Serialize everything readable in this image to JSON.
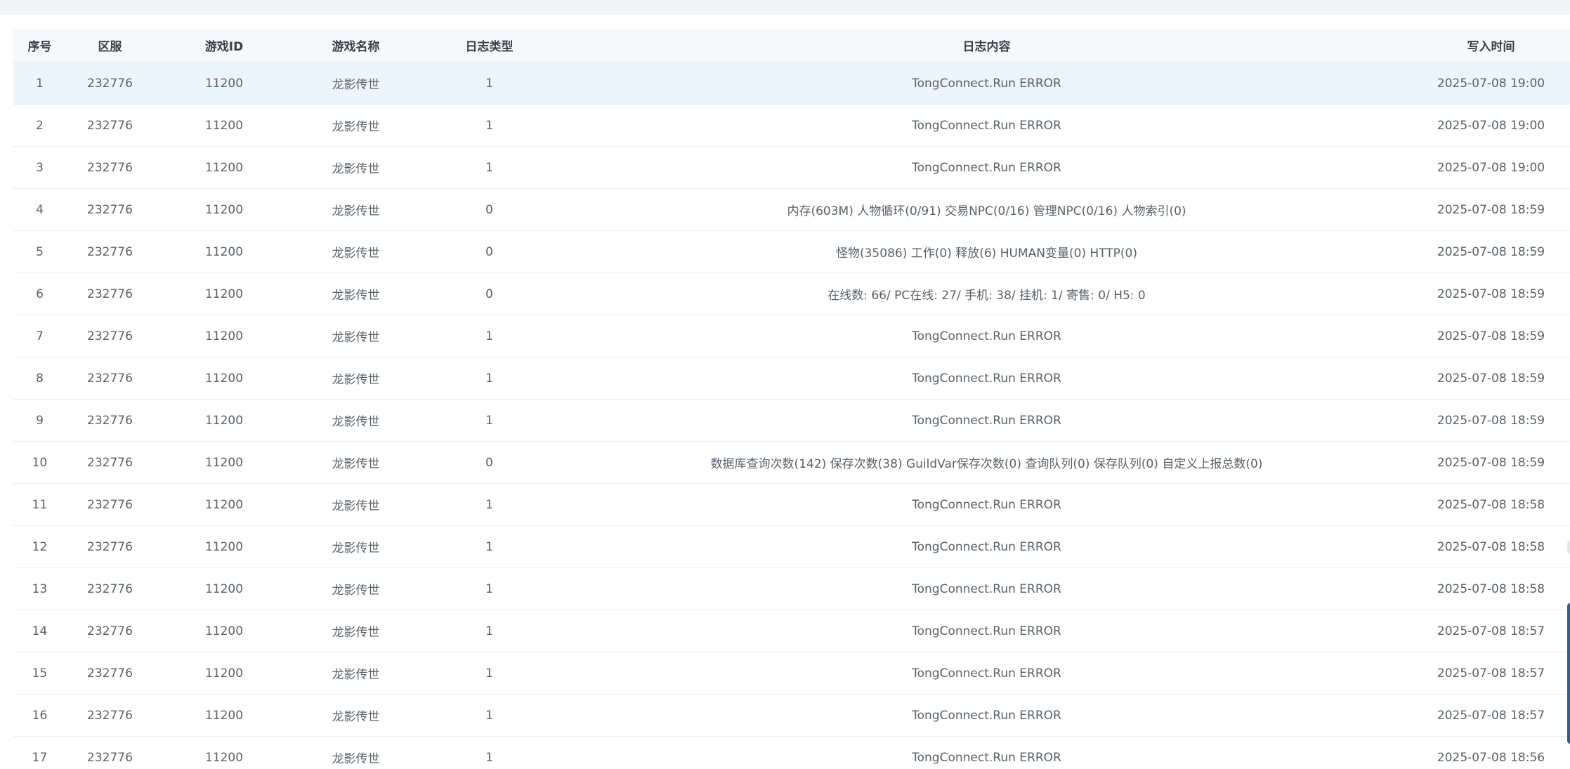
{
  "table": {
    "headers": [
      "序号",
      "区服",
      "游戏ID",
      "游戏名称",
      "日志类型",
      "日志内容",
      "写入时间"
    ],
    "rows": [
      {
        "index": "1",
        "server": "232776",
        "game_id": "11200",
        "game_name": "龙影传世",
        "log_type": "1",
        "content": "TongConnect.Run ERROR",
        "time": "2025-07-08 19:00"
      },
      {
        "index": "2",
        "server": "232776",
        "game_id": "11200",
        "game_name": "龙影传世",
        "log_type": "1",
        "content": "TongConnect.Run ERROR",
        "time": "2025-07-08 19:00"
      },
      {
        "index": "3",
        "server": "232776",
        "game_id": "11200",
        "game_name": "龙影传世",
        "log_type": "1",
        "content": "TongConnect.Run ERROR",
        "time": "2025-07-08 19:00"
      },
      {
        "index": "4",
        "server": "232776",
        "game_id": "11200",
        "game_name": "龙影传世",
        "log_type": "0",
        "content": "内存(603M) 人物循环(0/91) 交易NPC(0/16) 管理NPC(0/16) 人物索引(0)",
        "time": "2025-07-08 18:59"
      },
      {
        "index": "5",
        "server": "232776",
        "game_id": "11200",
        "game_name": "龙影传世",
        "log_type": "0",
        "content": "怪物(35086) 工作(0) 释放(6) HUMAN变量(0) HTTP(0)",
        "time": "2025-07-08 18:59"
      },
      {
        "index": "6",
        "server": "232776",
        "game_id": "11200",
        "game_name": "龙影传世",
        "log_type": "0",
        "content": "在线数: 66/ PC在线: 27/ 手机: 38/ 挂机: 1/ 寄售: 0/ H5: 0",
        "time": "2025-07-08 18:59"
      },
      {
        "index": "7",
        "server": "232776",
        "game_id": "11200",
        "game_name": "龙影传世",
        "log_type": "1",
        "content": "TongConnect.Run ERROR",
        "time": "2025-07-08 18:59"
      },
      {
        "index": "8",
        "server": "232776",
        "game_id": "11200",
        "game_name": "龙影传世",
        "log_type": "1",
        "content": "TongConnect.Run ERROR",
        "time": "2025-07-08 18:59"
      },
      {
        "index": "9",
        "server": "232776",
        "game_id": "11200",
        "game_name": "龙影传世",
        "log_type": "1",
        "content": "TongConnect.Run ERROR",
        "time": "2025-07-08 18:59"
      },
      {
        "index": "10",
        "server": "232776",
        "game_id": "11200",
        "game_name": "龙影传世",
        "log_type": "0",
        "content": "数据库查询次数(142) 保存次数(38) GuildVar保存次数(0) 查询队列(0) 保存队列(0) 自定义上报总数(0)",
        "time": "2025-07-08 18:59"
      },
      {
        "index": "11",
        "server": "232776",
        "game_id": "11200",
        "game_name": "龙影传世",
        "log_type": "1",
        "content": "TongConnect.Run ERROR",
        "time": "2025-07-08 18:58"
      },
      {
        "index": "12",
        "server": "232776",
        "game_id": "11200",
        "game_name": "龙影传世",
        "log_type": "1",
        "content": "TongConnect.Run ERROR",
        "time": "2025-07-08 18:58"
      },
      {
        "index": "13",
        "server": "232776",
        "game_id": "11200",
        "game_name": "龙影传世",
        "log_type": "1",
        "content": "TongConnect.Run ERROR",
        "time": "2025-07-08 18:58"
      },
      {
        "index": "14",
        "server": "232776",
        "game_id": "11200",
        "game_name": "龙影传世",
        "log_type": "1",
        "content": "TongConnect.Run ERROR",
        "time": "2025-07-08 18:57"
      },
      {
        "index": "15",
        "server": "232776",
        "game_id": "11200",
        "game_name": "龙影传世",
        "log_type": "1",
        "content": "TongConnect.Run ERROR",
        "time": "2025-07-08 18:57"
      },
      {
        "index": "16",
        "server": "232776",
        "game_id": "11200",
        "game_name": "龙影传世",
        "log_type": "1",
        "content": "TongConnect.Run ERROR",
        "time": "2025-07-08 18:57"
      },
      {
        "index": "17",
        "server": "232776",
        "game_id": "11200",
        "game_name": "龙影传世",
        "log_type": "1",
        "content": "TongConnect.Run ERROR",
        "time": "2025-07-08 18:56"
      }
    ]
  },
  "colors": {
    "page_bg": "#f3f4f6",
    "header_bg": "#f7f8fa",
    "selected_row_bg": "#ecf5fd",
    "row_border": "#ebedf0",
    "side_handle": "#2d5d9a"
  }
}
